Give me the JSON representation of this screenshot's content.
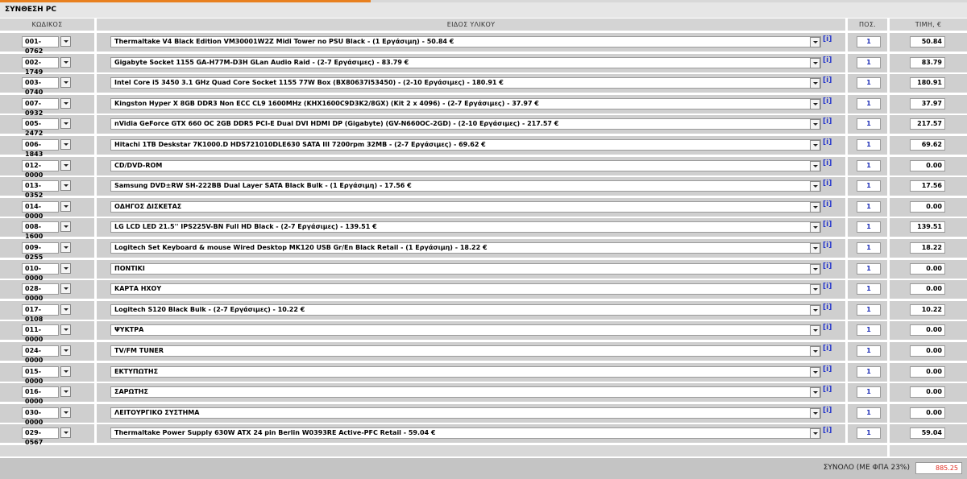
{
  "title": "ΣΥΝΘΕΣΗ PC",
  "columns": {
    "code": "ΚΩΔΙΚΟΣ",
    "item": "ΕΙΔΟΣ ΥΛΙΚΟΥ",
    "qty": "ΠΟΣ.",
    "price": "ΤΙΜΗ, €"
  },
  "info_label": "[i]",
  "rows": [
    {
      "code": "001-0762",
      "item": "Thermaltake V4 Black Edition VM30001W2Z Midi Tower no PSU Black - (1 Εργάσιμη) - 50.84 €",
      "qty": "1",
      "price": "50.84"
    },
    {
      "code": "002-1749",
      "item": "Gigabyte Socket 1155 GA-H77M-D3H GLan Audio Raid - (2-7 Εργάσιμες) - 83.79 €",
      "qty": "1",
      "price": "83.79"
    },
    {
      "code": "003-0740",
      "item": "Intel Core i5 3450 3.1 GHz Quad Core Socket 1155 77W Box (BX80637i53450) - (2-10 Εργάσιμες) - 180.91 €",
      "qty": "1",
      "price": "180.91"
    },
    {
      "code": "007-0932",
      "item": "Kingston Hyper X 8GB DDR3 Non ECC CL9 1600MHz (KHX1600C9D3K2/8GX) (Kit 2 x 4096) - (2-7 Εργάσιμες) - 37.97 €",
      "qty": "1",
      "price": "37.97"
    },
    {
      "code": "005-2472",
      "item": "nVidia GeForce GTX 660 OC 2GB DDR5 PCI-E Dual DVI HDMI DP (Gigabyte) (GV-N660OC-2GD) - (2-10 Εργάσιμες) - 217.57 €",
      "qty": "1",
      "price": "217.57"
    },
    {
      "code": "006-1843",
      "item": "Hitachi 1TB Deskstar 7K1000.D HDS721010DLE630 SATA III 7200rpm 32MB - (2-7 Εργάσιμες) - 69.62 €",
      "qty": "1",
      "price": "69.62"
    },
    {
      "code": "012-0000",
      "item": "CD/DVD-ROM",
      "qty": "1",
      "price": "0.00"
    },
    {
      "code": "013-0352",
      "item": "Samsung DVD±RW SH-222BB Dual Layer SATA Black Bulk - (1 Εργάσιμη) - 17.56 €",
      "qty": "1",
      "price": "17.56"
    },
    {
      "code": "014-0000",
      "item": "ΟΔΗΓΟΣ ΔΙΣΚΕΤΑΣ",
      "qty": "1",
      "price": "0.00"
    },
    {
      "code": "008-1600",
      "item": "LG LCD LED 21.5'' IPS225V-BN Full HD Black - (2-7 Εργάσιμες) - 139.51 €",
      "qty": "1",
      "price": "139.51"
    },
    {
      "code": "009-0255",
      "item": "Logitech Set Keyboard & mouse Wired Desktop MK120 USB Gr/En Black Retail - (1 Εργάσιμη) - 18.22 €",
      "qty": "1",
      "price": "18.22"
    },
    {
      "code": "010-0000",
      "item": "ΠΟΝΤΙΚΙ",
      "qty": "1",
      "price": "0.00"
    },
    {
      "code": "028-0000",
      "item": "ΚΑΡΤΑ ΗΧΟΥ",
      "qty": "1",
      "price": "0.00"
    },
    {
      "code": "017-0108",
      "item": "Logitech S120 Black Bulk - (2-7 Εργάσιμες) - 10.22 €",
      "qty": "1",
      "price": "10.22"
    },
    {
      "code": "011-0000",
      "item": "ΨΥΚΤΡΑ",
      "qty": "1",
      "price": "0.00"
    },
    {
      "code": "024-0000",
      "item": "TV/FM TUNER",
      "qty": "1",
      "price": "0.00"
    },
    {
      "code": "015-0000",
      "item": "ΕΚΤΥΠΩΤΗΣ",
      "qty": "1",
      "price": "0.00"
    },
    {
      "code": "016-0000",
      "item": "ΣΑΡΩΤΗΣ",
      "qty": "1",
      "price": "0.00"
    },
    {
      "code": "030-0000",
      "item": "ΛΕΙΤΟΥΡΓΙΚΟ ΣΥΣΤΗΜΑ",
      "qty": "1",
      "price": "0.00"
    },
    {
      "code": "029-0567",
      "item": "Thermaltake Power Supply 630W ATX 24 pin Berlin W0393RE Active-PFC Retail - 59.04 €",
      "qty": "1",
      "price": "59.04"
    }
  ],
  "total": {
    "label": "ΣΥΝΟΛΟ (ΜΕ ΦΠΑ 23%)",
    "value": "885.25"
  },
  "colors": {
    "accent": "#e8801f",
    "total_value": "#e0261a",
    "qty_text": "#1a2bb5",
    "info_link": "#2233cc"
  }
}
